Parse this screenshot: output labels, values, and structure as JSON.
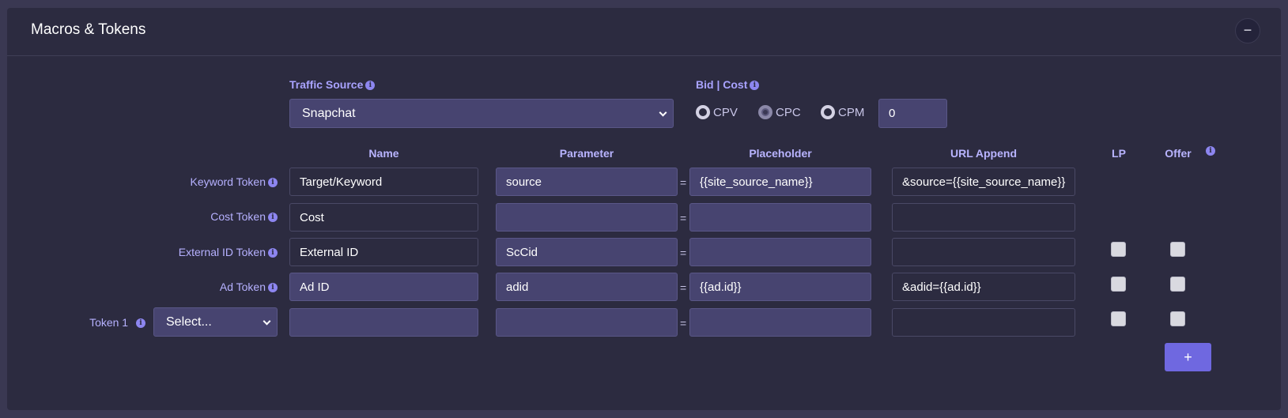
{
  "card": {
    "title": "Macros & Tokens",
    "collapse_label": "−"
  },
  "traffic_source": {
    "label": "Traffic Source",
    "selected": "Snapchat"
  },
  "bid_cost": {
    "label": "Bid | Cost",
    "options": [
      "CPV",
      "CPC",
      "CPM"
    ],
    "selected": "CPC",
    "value": "0"
  },
  "columns": {
    "name": "Name",
    "parameter": "Parameter",
    "placeholder": "Placeholder",
    "url_append": "URL Append",
    "lp": "LP",
    "offer": "Offer"
  },
  "rows": [
    {
      "label": "Keyword Token",
      "name": "Target/Keyword",
      "parameter": "source",
      "placeholder": "{{site_source_name}}",
      "url_append": "&source={{site_source_name}}",
      "has_checkboxes": false
    },
    {
      "label": "Cost Token",
      "name": "Cost",
      "parameter": "",
      "placeholder": "",
      "url_append": "",
      "has_checkboxes": false
    },
    {
      "label": "External ID Token",
      "name": "External ID",
      "parameter": "ScCid",
      "placeholder": "",
      "url_append": "",
      "has_checkboxes": true
    },
    {
      "label": "Ad Token",
      "name": "Ad ID",
      "parameter": "adid",
      "placeholder": "{{ad.id}}",
      "url_append": "&adid={{ad.id}}",
      "has_checkboxes": true
    },
    {
      "label": "Token 1",
      "select": "Select...",
      "name": "",
      "parameter": "",
      "placeholder": "",
      "url_append": "",
      "has_checkboxes": true
    }
  ],
  "equals": "=",
  "add_button": "+",
  "colors": {
    "background": "#3a3852",
    "card": "#2c2b40",
    "accent": "#6f68e0",
    "label": "#a9a3ff",
    "input_filled": "#474470"
  }
}
